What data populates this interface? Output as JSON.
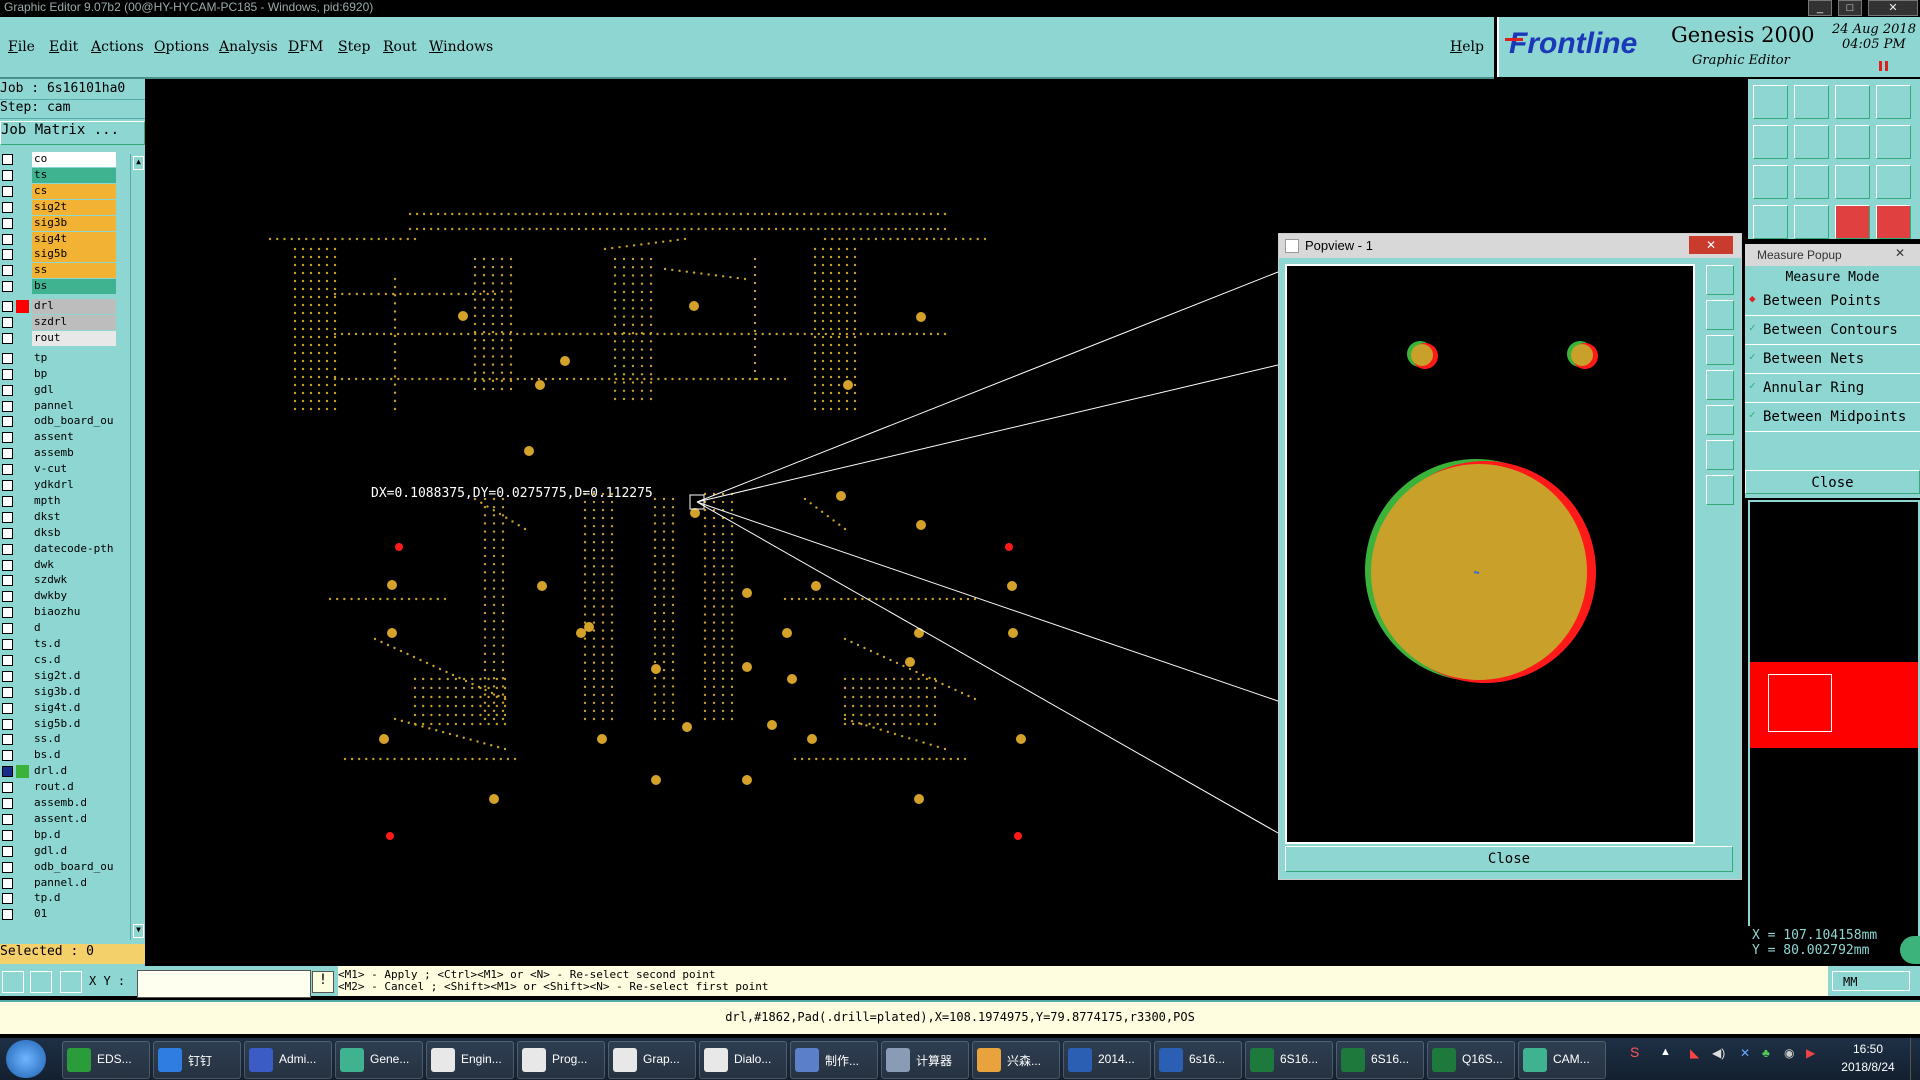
{
  "window": {
    "title": "Graphic Editor 9.07b2 (00@HY-HYCAM-PC185 - Windows, pid:6920)"
  },
  "menu": [
    "File",
    "Edit",
    "Actions",
    "Options",
    "Analysis",
    "DFM",
    "Step",
    "Rout",
    "Windows"
  ],
  "help": "Help",
  "brand": {
    "logo": "Frontline",
    "product": "Genesis 2000",
    "date": "24 Aug 2018",
    "time": "04:05 PM",
    "module": "Graphic Editor"
  },
  "job": {
    "job": "Job : 6s16101ha0",
    "step": "Step: cam",
    "matrix_button": "Job Matrix ..."
  },
  "layers": [
    {
      "name": "co",
      "color": "#ffffff"
    },
    {
      "name": "ts",
      "color": "#3fb28f"
    },
    {
      "name": "cs",
      "color": "#f2b233"
    },
    {
      "name": "sig2t",
      "color": "#f2b233"
    },
    {
      "name": "sig3b",
      "color": "#f2b233"
    },
    {
      "name": "sig4t",
      "color": "#f2b233"
    },
    {
      "name": "sig5b",
      "color": "#f2b233"
    },
    {
      "name": "ss",
      "color": "#f2b233"
    },
    {
      "name": "bs",
      "color": "#3fb28f"
    },
    {
      "name": "drl",
      "color": "#bdbdbd",
      "swatch": "#ff0000"
    },
    {
      "name": "szdrl",
      "color": "#bdbdbd"
    },
    {
      "name": "rout",
      "color": "#e8e8e8"
    },
    {
      "name": "tp",
      "color": "#8ed6d2"
    },
    {
      "name": "bp",
      "color": "#8ed6d2"
    },
    {
      "name": "gdl",
      "color": "#8ed6d2"
    },
    {
      "name": "pannel",
      "color": "#8ed6d2"
    },
    {
      "name": "odb_board_ou",
      "color": "#8ed6d2"
    },
    {
      "name": "assent",
      "color": "#8ed6d2"
    },
    {
      "name": "assemb",
      "color": "#8ed6d2"
    },
    {
      "name": "v-cut",
      "color": "#8ed6d2"
    },
    {
      "name": "ydkdrl",
      "color": "#8ed6d2"
    },
    {
      "name": "mpth",
      "color": "#8ed6d2"
    },
    {
      "name": "dkst",
      "color": "#8ed6d2"
    },
    {
      "name": "dksb",
      "color": "#8ed6d2"
    },
    {
      "name": "datecode-pth",
      "color": "#8ed6d2"
    },
    {
      "name": "dwk",
      "color": "#8ed6d2"
    },
    {
      "name": "szdwk",
      "color": "#8ed6d2"
    },
    {
      "name": "dwkby",
      "color": "#8ed6d2"
    },
    {
      "name": "biaozhu",
      "color": "#8ed6d2"
    },
    {
      "name": "d",
      "color": "#8ed6d2"
    },
    {
      "name": "ts.d",
      "color": "#8ed6d2"
    },
    {
      "name": "cs.d",
      "color": "#8ed6d2"
    },
    {
      "name": "sig2t.d",
      "color": "#8ed6d2"
    },
    {
      "name": "sig3b.d",
      "color": "#8ed6d2"
    },
    {
      "name": "sig4t.d",
      "color": "#8ed6d2"
    },
    {
      "name": "sig5b.d",
      "color": "#8ed6d2"
    },
    {
      "name": "ss.d",
      "color": "#8ed6d2"
    },
    {
      "name": "bs.d",
      "color": "#8ed6d2"
    },
    {
      "name": "drl.d",
      "color": "#8ed6d2",
      "swatch": "#3bb33b",
      "checked": true
    },
    {
      "name": "rout.d",
      "color": "#8ed6d2"
    },
    {
      "name": "assemb.d",
      "color": "#8ed6d2"
    },
    {
      "name": "assent.d",
      "color": "#8ed6d2"
    },
    {
      "name": "bp.d",
      "color": "#8ed6d2"
    },
    {
      "name": "gdl.d",
      "color": "#8ed6d2"
    },
    {
      "name": "odb_board_ou",
      "color": "#8ed6d2"
    },
    {
      "name": "pannel.d",
      "color": "#8ed6d2"
    },
    {
      "name": "tp.d",
      "color": "#8ed6d2"
    },
    {
      "name": "01",
      "color": "#8ed6d2"
    }
  ],
  "selected": "Selected : 0",
  "measurement": "DX=0.1088375,DY=0.0275775,D=0.112275",
  "popview": {
    "title": "Popview - 1",
    "close": "Close"
  },
  "measure_popup": {
    "title": "Measure Popup",
    "header": "Measure Mode",
    "items": [
      "Between Points",
      "Between Contours",
      "Between Nets",
      "Annular Ring",
      "Between Midpoints"
    ],
    "close": "Close"
  },
  "coords": {
    "x": "X = 107.104158mm",
    "y": "Y =  80.002792mm"
  },
  "xy_label": "X Y :",
  "hints": {
    "line1": "<M1> - Apply  ; <Ctrl><M1> or <N> - Re-select second point",
    "line2": "<M2> - Cancel ; <Shift><M1> or <Shift><N> - Re-select first point"
  },
  "units": "MM",
  "status_line": "drl,#1862,Pad(.drill=plated),X=108.1974975,Y=79.8774175,r3300,POS",
  "taskbar": {
    "items": [
      {
        "label": "EDS...",
        "color": "#2a9d3a"
      },
      {
        "label": "钉钉",
        "color": "#2f7de1"
      },
      {
        "label": "Admi...",
        "color": "#3b5cc4"
      },
      {
        "label": "Gene...",
        "color": "#3fb28f"
      },
      {
        "label": "Engin...",
        "color": "#e8e8e8"
      },
      {
        "label": "Prog...",
        "color": "#e8e8e8"
      },
      {
        "label": "Grap...",
        "color": "#e8e8e8"
      },
      {
        "label": "Dialo...",
        "color": "#e8e8e8"
      },
      {
        "label": "制作...",
        "color": "#5b7fc9"
      },
      {
        "label": "计算器",
        "color": "#8a9bb5"
      },
      {
        "label": "兴森...",
        "color": "#e8a33c"
      },
      {
        "label": "2014...",
        "color": "#2b5fb4"
      },
      {
        "label": "6s16...",
        "color": "#2b5fb4"
      },
      {
        "label": "6S16...",
        "color": "#1e7a3c"
      },
      {
        "label": "6S16...",
        "color": "#1e7a3c"
      },
      {
        "label": "Q16S...",
        "color": "#1e7a3c"
      },
      {
        "label": "CAM...",
        "color": "#3fb28f"
      }
    ],
    "clock_time": "16:50",
    "clock_date": "2018/8/24"
  }
}
